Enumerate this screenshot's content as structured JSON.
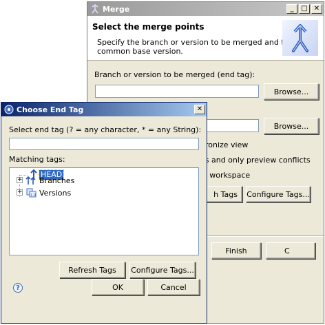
{
  "merge": {
    "title": "Merge",
    "header_title": "Select the merge points",
    "header_desc_line1": "Specify the branch or version to be merged and the",
    "header_desc_line2": "common base version.",
    "end_tag_label": "Branch or version to be merged (end tag):",
    "browse1": "Browse...",
    "browse2": "Browse...",
    "opt1_partial": "hronize view",
    "opt2_partial": "es and only preview conflicts",
    "opt3_partial": "al workspace",
    "refresh_partial": "h Tags",
    "configure": "Configure Tags...",
    "finish": "Finish",
    "cancel_partial": "C"
  },
  "choose": {
    "title": "Choose End Tag",
    "filter_label": "Select end tag (? = any character, * = any String):",
    "filter_value": "",
    "matching_label": "Matching tags:",
    "tree": [
      {
        "label": "HEAD",
        "icon": "head-tag-icon"
      },
      {
        "label": "Branches",
        "icon": "branches-icon"
      },
      {
        "label": "Versions",
        "icon": "versions-icon"
      }
    ],
    "refresh_tags": "Refresh Tags",
    "configure_tags": "Configure Tags...",
    "ok": "OK",
    "cancel": "Cancel"
  },
  "colors": {
    "selection": "#316ac5",
    "dialog_bg": "#ece9d8",
    "active_title": "#0a246a"
  }
}
